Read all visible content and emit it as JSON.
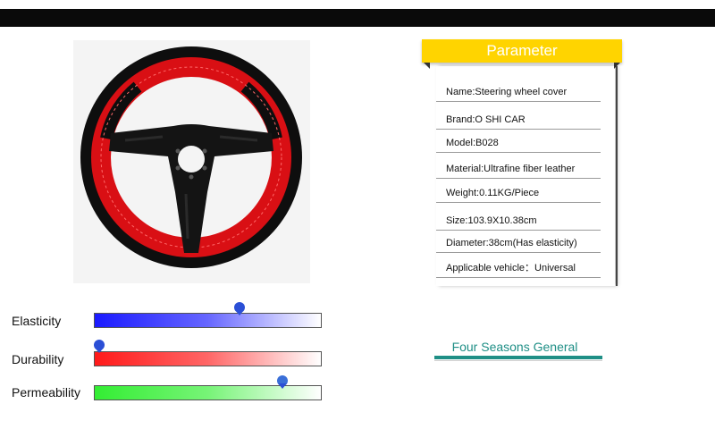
{
  "product": {
    "image_alt": "steering-wheel-cover"
  },
  "parameter": {
    "title": "Parameter",
    "rows": [
      "Name:Steering wheel cover",
      "Brand:O SHI CAR",
      "Model:B028",
      "Material:Ultrafine fiber leather",
      "Weight:0.11KG/Piece",
      "Size:103.9X10.38cm",
      "Diameter:38cm(Has elasticity)",
      "Applicable vehicle：Universal"
    ],
    "header_color": "#ffd400"
  },
  "meters": [
    {
      "label": "Elasticity",
      "level": 0.64,
      "color": "#1a1aff"
    },
    {
      "label": "Durability",
      "level": 0.02,
      "color": "#ff1a1a"
    },
    {
      "label": "Permeability",
      "level": 0.83,
      "color": "#33ee33"
    }
  ],
  "badge": {
    "text": "Four Seasons General",
    "color": "#1f8f86"
  }
}
